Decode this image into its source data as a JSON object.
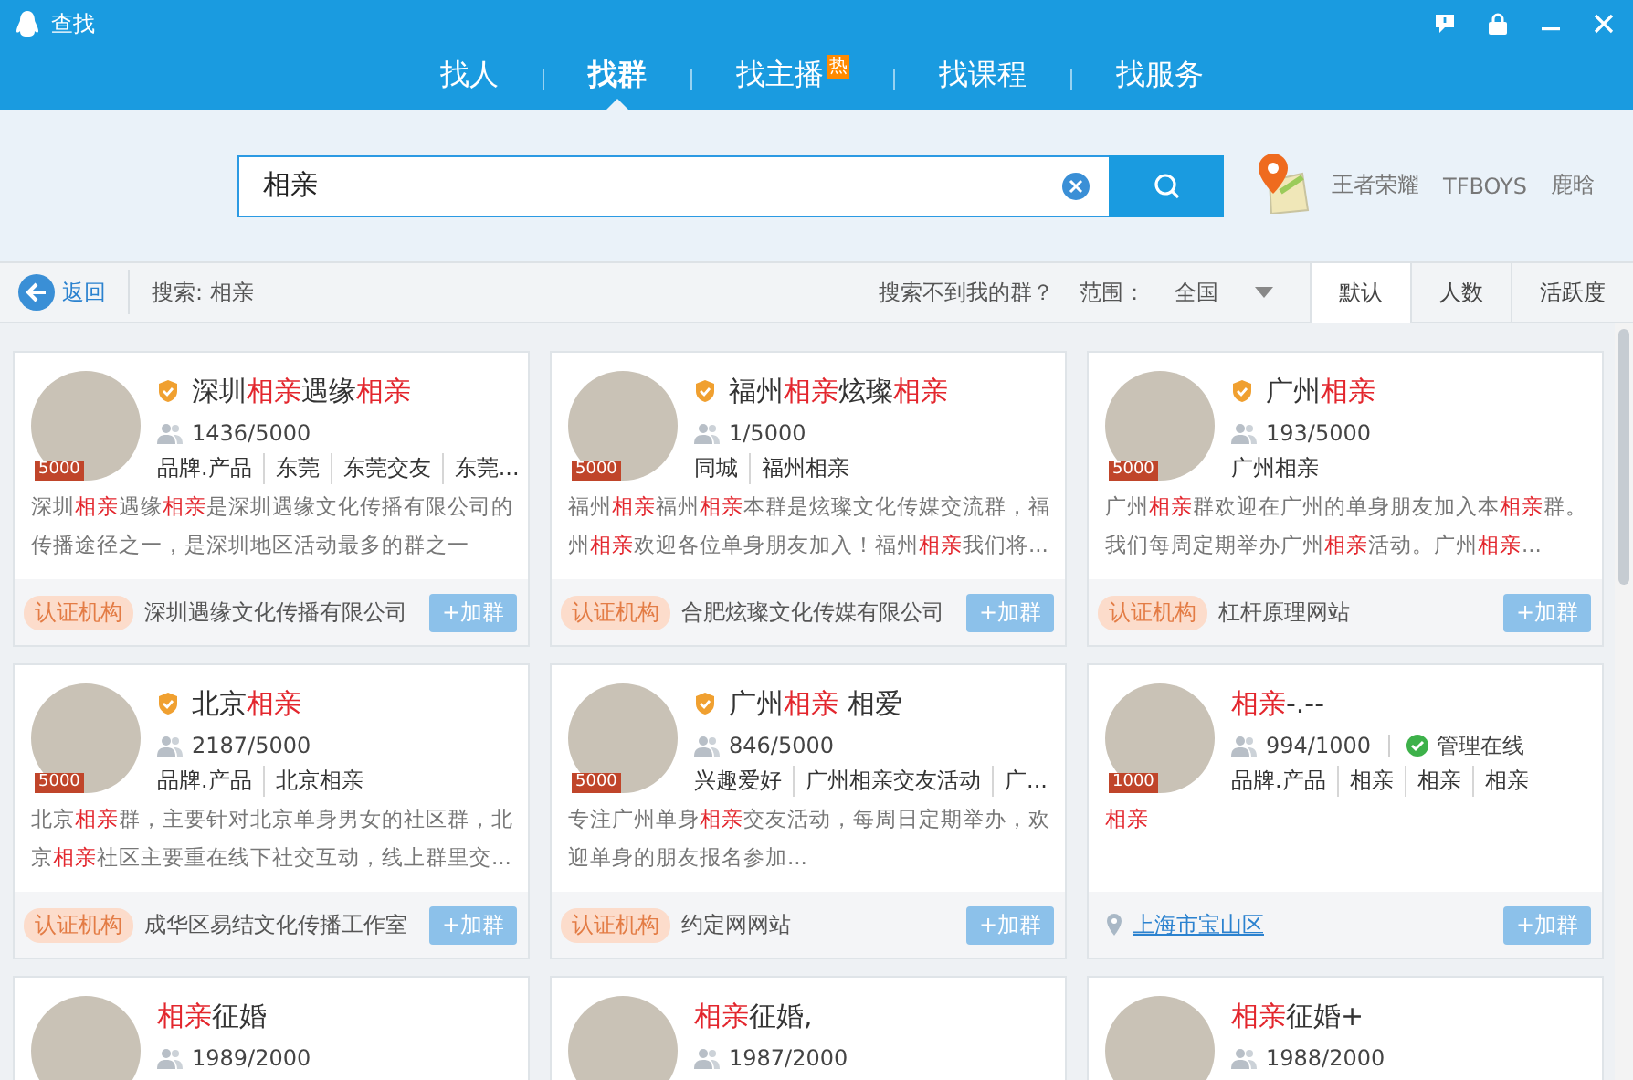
{
  "window": {
    "title": "查找"
  },
  "tabs": [
    {
      "label": "找人",
      "selected": false
    },
    {
      "label": "找群",
      "selected": true
    },
    {
      "label": "找主播",
      "selected": false,
      "badge": "热"
    },
    {
      "label": "找课程",
      "selected": false
    },
    {
      "label": "找服务",
      "selected": false
    }
  ],
  "search": {
    "value": "相亲",
    "hot_words": [
      "王者荣耀",
      "TFBOYS",
      "鹿晗"
    ]
  },
  "toolbar": {
    "back": "返回",
    "query": "搜索: 相亲",
    "not_found": "搜索不到我的群？",
    "range_label": "范围：",
    "range_value": "全国",
    "sort_tabs": [
      {
        "label": "默认",
        "selected": true
      },
      {
        "label": "人数",
        "selected": false
      },
      {
        "label": "活跃度",
        "selected": false
      }
    ]
  },
  "groups": [
    {
      "badge": "5000",
      "verified": true,
      "title": "深圳**相亲**遇缘**相亲**",
      "members": "1436/5000",
      "tags": [
        "品牌.产品",
        "东莞",
        "东莞交友",
        "东莞..."
      ],
      "description": "深圳**相亲**遇缘**相亲**是深圳遇缘文化传播有限公司的传播途径之一，是深圳地区活动最多的群之一",
      "footer": {
        "kind": "certified",
        "tag": "认证机构",
        "text": "深圳遇缘文化传播有限公司"
      },
      "join": "+加群"
    },
    {
      "badge": "5000",
      "verified": true,
      "title": "福州**相亲**炫璨**相亲**",
      "members": "1/5000",
      "tags": [
        "同城",
        "福州相亲"
      ],
      "description": "福州**相亲**福州**相亲**本群是炫璨文化传媒交流群，福州**相亲**欢迎各位单身朋友加入！福州**相亲**我们将...",
      "footer": {
        "kind": "certified",
        "tag": "认证机构",
        "text": "合肥炫璨文化传媒有限公司"
      },
      "join": "+加群"
    },
    {
      "badge": "5000",
      "verified": true,
      "title": "广州**相亲**",
      "members": "193/5000",
      "tags": [
        "广州相亲"
      ],
      "description": "广州**相亲**群欢迎在广州的单身朋友加入本**相亲**群。我们每周定期举办广州**相亲**活动。广州**相亲**...",
      "footer": {
        "kind": "certified",
        "tag": "认证机构",
        "text": "杠杆原理网站"
      },
      "join": "+加群"
    },
    {
      "badge": "5000",
      "verified": true,
      "title": "北京**相亲**",
      "members": "2187/5000",
      "tags": [
        "品牌.产品",
        "北京相亲"
      ],
      "description": "北京**相亲**群，主要针对北京单身男女的社区群，北京**相亲**社区主要重在线下社交互动，线上群里交...",
      "footer": {
        "kind": "certified",
        "tag": "认证机构",
        "text": "成华区易结文化传播工作室"
      },
      "join": "+加群"
    },
    {
      "badge": "5000",
      "verified": true,
      "title": "广州**相亲** 相爱",
      "members": "846/5000",
      "tags": [
        "兴趣爱好",
        "广州相亲交友活动",
        "广..."
      ],
      "description": "专注广州单身**相亲**交友活动，每周日定期举办，欢迎单身的朋友报名参加...",
      "footer": {
        "kind": "certified",
        "tag": "认证机构",
        "text": "约定网网站"
      },
      "join": "+加群"
    },
    {
      "badge": "1000",
      "verified": false,
      "admin_online": "管理在线",
      "title": "**相亲**-.--",
      "members": "994/1000",
      "tags": [
        "品牌.产品",
        "相亲",
        "相亲",
        "相亲"
      ],
      "description": "**相亲**",
      "footer": {
        "kind": "location",
        "text": "上海市宝山区"
      },
      "join": "+加群"
    },
    {
      "verified": false,
      "title": "**相亲**征婚",
      "members": "1989/2000"
    },
    {
      "verified": false,
      "title": "**相亲**征婚,",
      "members": "1987/2000"
    },
    {
      "verified": false,
      "title": "**相亲**征婚+",
      "members": "1988/2000"
    }
  ]
}
